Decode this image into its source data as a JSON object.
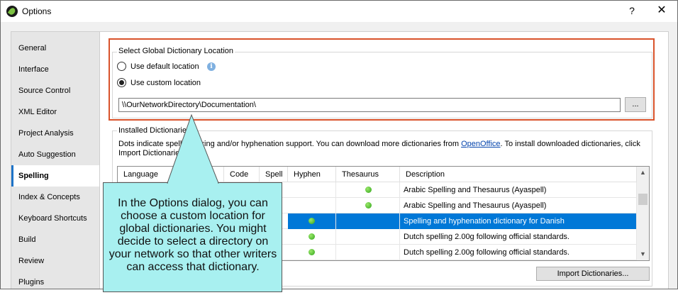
{
  "window": {
    "title": "Options",
    "help_label": "?",
    "close_label": "✕"
  },
  "nav": {
    "items": [
      {
        "label": "General"
      },
      {
        "label": "Interface"
      },
      {
        "label": "Source Control"
      },
      {
        "label": "XML Editor"
      },
      {
        "label": "Project Analysis"
      },
      {
        "label": "Auto Suggestion"
      },
      {
        "label": "Spelling",
        "selected": true
      },
      {
        "label": "Index & Concepts"
      },
      {
        "label": "Keyboard Shortcuts"
      },
      {
        "label": "Build"
      },
      {
        "label": "Review"
      },
      {
        "label": "Plugins"
      }
    ]
  },
  "global_location": {
    "legend": "Select Global Dictionary Location",
    "option_default": "Use default location",
    "option_custom": "Use custom location",
    "selected": "custom",
    "path_value": "\\\\OurNetworkDirectory\\Documentation\\",
    "browse_label": "...",
    "info_icon": "info-icon"
  },
  "installed": {
    "legend": "Installed Dictionaries",
    "desc_prefix": "Dots indicate spell checking and/or hyphenation support. You can download more dictionaries from ",
    "link_text": "OpenOffice",
    "desc_suffix": ". To install downloaded dictionaries, click Import Dictionaries.",
    "columns": [
      "Language",
      "Code",
      "Spell",
      "Hyphen",
      "Thesaurus",
      "Description"
    ],
    "rows": [
      {
        "hyphen": false,
        "thesaurus": true,
        "description": "Arabic Spelling and Thesaurus (Ayaspell)",
        "selected": false
      },
      {
        "hyphen": false,
        "thesaurus": true,
        "description": "Arabic Spelling and Thesaurus (Ayaspell)",
        "selected": false
      },
      {
        "hyphen": true,
        "thesaurus": false,
        "description": "Spelling and hyphenation dictionary for Danish",
        "selected": true
      },
      {
        "hyphen": true,
        "thesaurus": false,
        "description": "Dutch spelling 2.00g following official standards.",
        "selected": false
      },
      {
        "hyphen": true,
        "thesaurus": false,
        "description": "Dutch spelling 2.00g following official standards.",
        "selected": false
      }
    ],
    "import_button": "Import Dictionaries..."
  },
  "callout": {
    "text": "In the Options dialog, you can choose a custom location for global dictionaries. You might decide to select a directory on your network so that other writers can access that dictionary."
  },
  "colors": {
    "highlight_border": "#d9532b",
    "callout_fill": "#a8f0f0",
    "selection": "#0078d7",
    "dot_green": "#2fa51a"
  }
}
